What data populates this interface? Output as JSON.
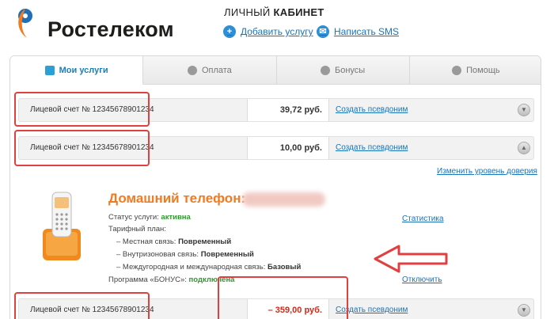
{
  "header": {
    "brand": "Ростелеком",
    "title_light": "ЛИЧНЫЙ",
    "title_bold": "КАБИНЕТ",
    "add_service": "Добавить услугу",
    "write_sms": "Написать SMS"
  },
  "tabs": [
    {
      "label": "Мои услуги",
      "icon": "home-icon"
    },
    {
      "label": "Оплата",
      "icon": "globe-icon"
    },
    {
      "label": "Бонусы",
      "icon": "gear-icon"
    },
    {
      "label": "Помощь",
      "icon": "question-icon"
    }
  ],
  "accounts": [
    {
      "label": "Лицевой счет № 12345678901234",
      "sum": "39,72 руб.",
      "alias": "Создать псевдоним"
    },
    {
      "label": "Лицевой счет № 12345678901234",
      "sum": "10,00 руб.",
      "alias": "Создать псевдоним"
    },
    {
      "label": "Лицевой счет № 12345678901234",
      "sum": "– 359,00 руб.",
      "alias": "Создать псевдоним"
    }
  ],
  "trust_link": "Изменить уровень доверия",
  "service": {
    "title": "Домашний телефон:",
    "status_label": "Статус услуги:",
    "status_value": "активна",
    "tariff_label": "Тарифный план:",
    "local_label": "– Местная связь:",
    "local_value": "Повременный",
    "zone_label": "– Внутризоновая связь:",
    "zone_value": "Повременный",
    "intl_label": "– Междугородная и международная связь:",
    "intl_value": "Базовый",
    "bonus_label": "Программа «БОНУС»:",
    "bonus_value": "подключена",
    "stats_link": "Статистика",
    "disable_link": "Отключить"
  },
  "colors": {
    "accent_blue": "#1a73b8",
    "brand_orange": "#f47a20",
    "negative_red": "#d32a1a",
    "highlight_red": "#e04040"
  }
}
